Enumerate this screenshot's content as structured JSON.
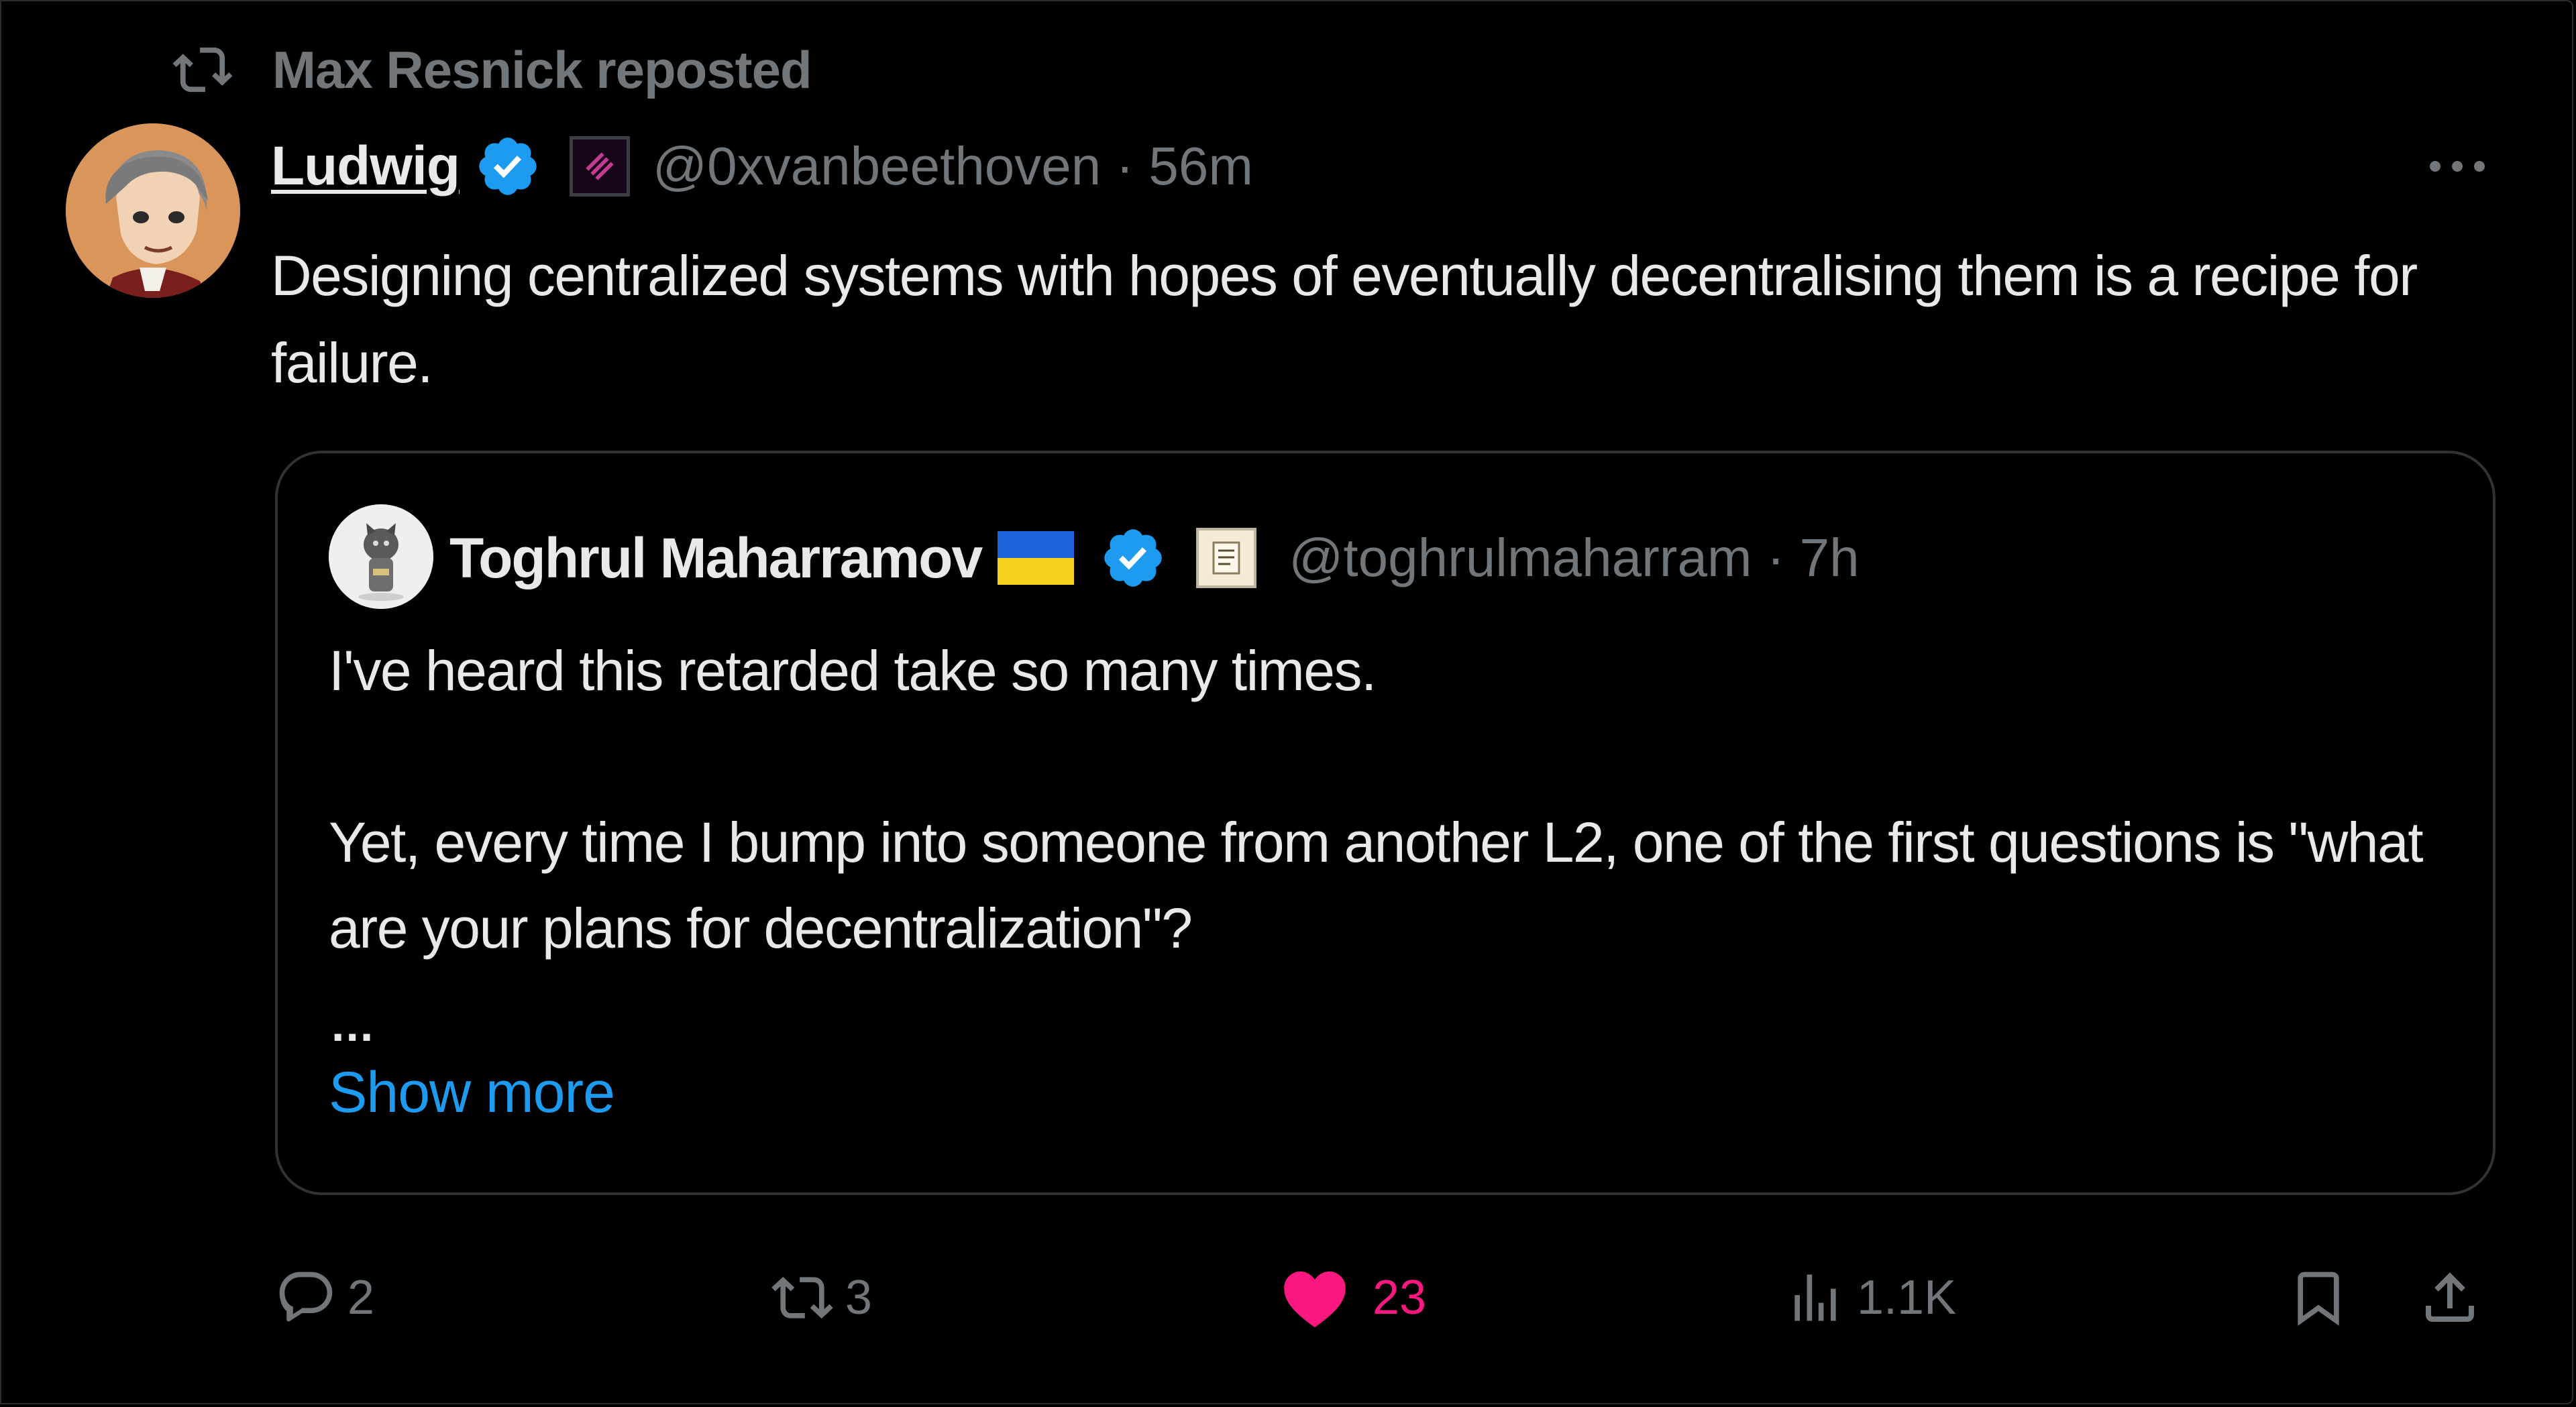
{
  "repost": {
    "icon": "repost-icon",
    "text": "Max Resnick reposted"
  },
  "tweet": {
    "author_name": "Ludwig",
    "handle_time": "@0xvanbeethoven · 56m",
    "text": "Designing centralized systems with hopes of eventually decentralising them is a recipe for failure.",
    "avatar": "cartoon-avatar",
    "more_icon": "more-icon"
  },
  "quoted": {
    "author_name": "Toghrul Maharramov",
    "handle_time": "@toghrulmaharram · 7h",
    "paragraph1": "I've heard this retarded take so many times.",
    "paragraph2": "Yet, every time I bump into someone from another L2, one of the first questions is \"what are your plans for decentralization\"?",
    "ellipsis": "...",
    "show_more": "Show more"
  },
  "actions": {
    "replies": "2",
    "reposts": "3",
    "likes": "23",
    "views": "1.1K"
  },
  "colors": {
    "background": "#000000",
    "text": "#e7e9ea",
    "muted": "#71767b",
    "link": "#1d9bf0",
    "like": "#f91880",
    "verified": "#1d9bf0",
    "border": "#2f3336"
  }
}
